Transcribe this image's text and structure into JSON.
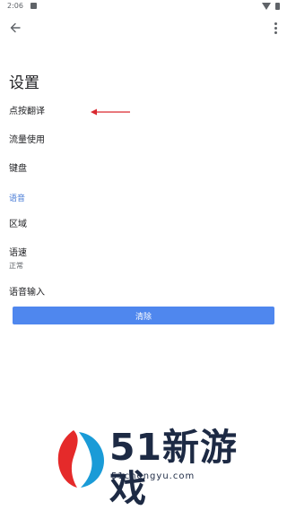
{
  "status_bar": {
    "time": "2:06"
  },
  "title": "设置",
  "settings": [
    {
      "label": "点按翻译"
    },
    {
      "label": "流量使用"
    },
    {
      "label": "键盘"
    }
  ],
  "voice_section": {
    "header": "语音",
    "items": [
      {
        "label": "区域"
      },
      {
        "label": "语速",
        "sub": "正常"
      },
      {
        "label": "语音输入"
      }
    ]
  },
  "clear_button": "清除",
  "watermark": {
    "name": "51新游戏",
    "url": "51chengyu.com"
  },
  "colors": {
    "accent": "#4f87ee",
    "section": "#4a7cd6",
    "annotation": "#d9282f"
  }
}
